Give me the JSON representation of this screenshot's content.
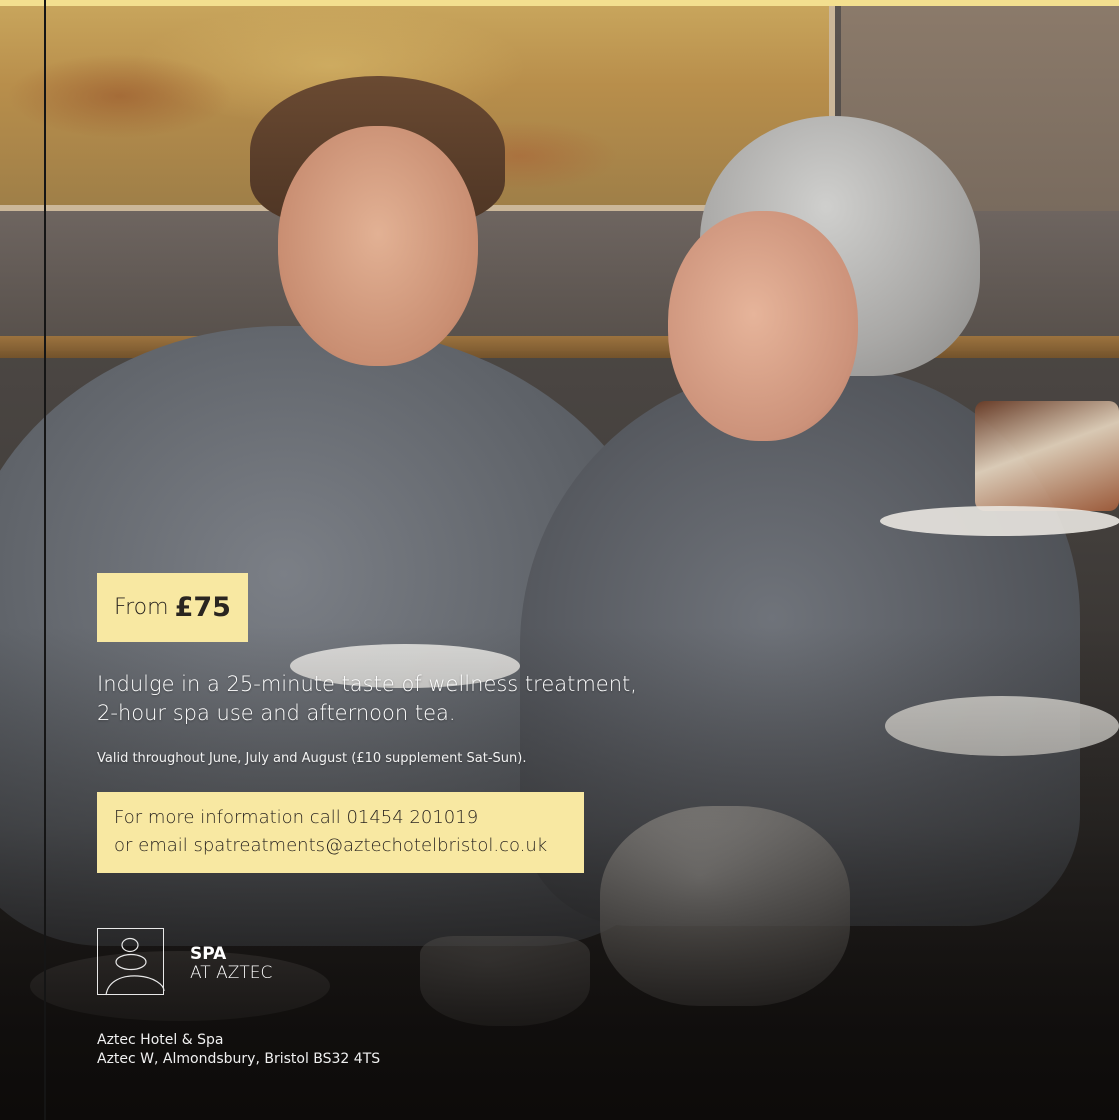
{
  "colors": {
    "accent_yellow": "#f8e8a2",
    "top_band": "#f3df8f",
    "text_dark": "#2a2520",
    "text_light": "#ffffff"
  },
  "offer": {
    "price_prefix": "From",
    "price": "£75"
  },
  "description": {
    "line1": "Indulge in a 25-minute taste of wellness treatment,",
    "line2": "2-hour spa use and afternoon tea."
  },
  "validity": "Valid throughout June, July and August (£10 supplement Sat-Sun).",
  "contact": {
    "line1": "For more information call 01454 201019",
    "line2": "or email spatreatments@aztechotelbristol.co.uk"
  },
  "brand": {
    "logo_icon": "stacked-stones-icon",
    "line1": "SPA",
    "line2": "AT AZTEC"
  },
  "address": {
    "line1": "Aztec Hotel & Spa",
    "line2": "Aztec W, Almondsbury, Bristol BS32 4TS"
  }
}
